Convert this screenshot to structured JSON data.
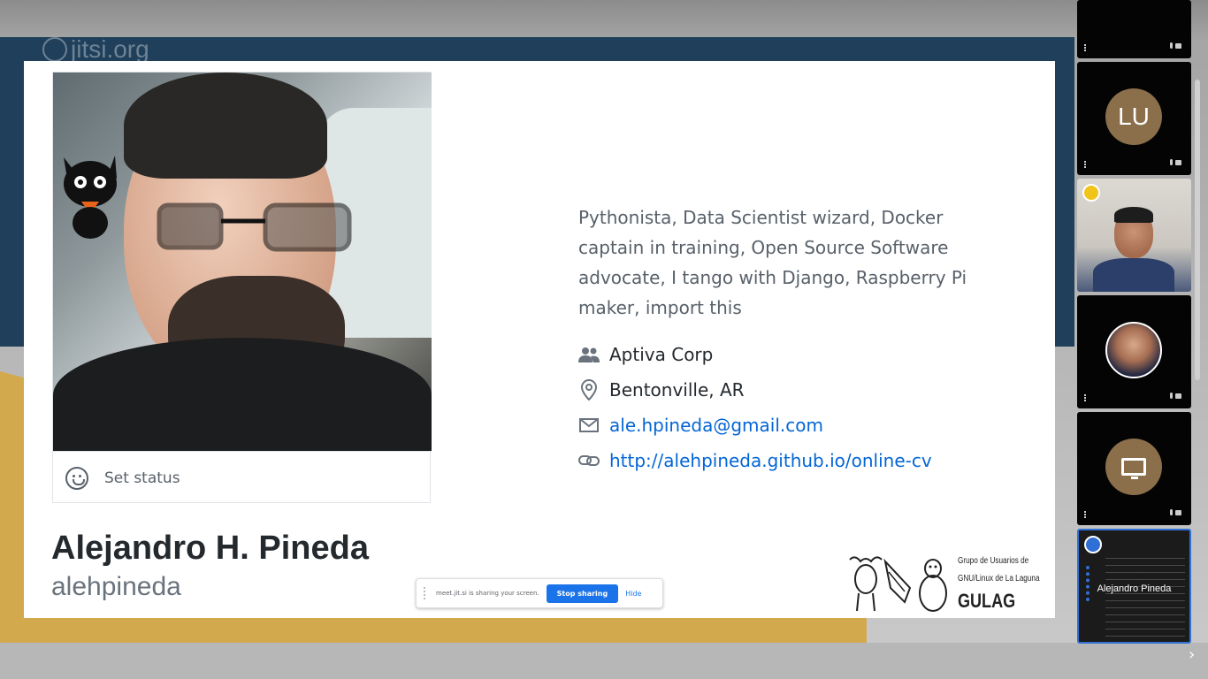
{
  "branding": {
    "watermark": "jitsi.org"
  },
  "profile": {
    "set_status_label": "Set status",
    "full_name": "Alejandro H. Pineda",
    "login": "alehpineda",
    "bio": "Pythonista, Data Scientist wizard, Docker captain in training, Open Source Software advocate, I tango with Django, Raspberry Pi maker, import this",
    "company": "Aptiva Corp",
    "location": "Bentonville, AR",
    "email": "ale.hpineda@gmail.com",
    "website": "http://alehpineda.github.io/online-cv"
  },
  "share_bar": {
    "message": "meet.jit.si is sharing your screen.",
    "stop_label": "Stop sharing",
    "hide_label": "Hide"
  },
  "gulag_logo": {
    "line1": "Grupo de Usuarios de",
    "line2": "GNU/Linux de La Laguna",
    "name": "GULAG"
  },
  "participants": [
    {
      "type": "cropped"
    },
    {
      "type": "initials",
      "initials": "LU"
    },
    {
      "type": "video"
    },
    {
      "type": "photo-avatar"
    },
    {
      "type": "screen-share"
    },
    {
      "type": "self",
      "display_name": "Alejandro Pineda"
    }
  ],
  "colors": {
    "link": "#0366d6",
    "stop_button": "#1a73e8",
    "avatar_bg": "#8b6e4a",
    "active_border": "#2f6fd6"
  }
}
